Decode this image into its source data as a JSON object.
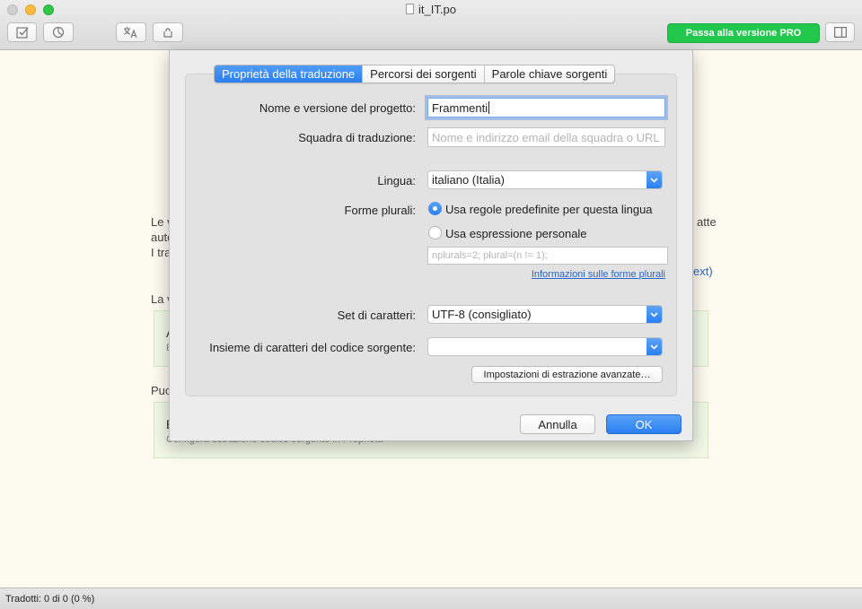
{
  "window": {
    "title": "it_IT.po",
    "pro_button": "Passa alla versione PRO"
  },
  "background": {
    "line1_start": "Le v",
    "line1_end": "atte",
    "line2_start": "auto",
    "line3_start": "I tra",
    "link_end": "ext)",
    "label_v": "La v",
    "card1_title": "A",
    "card1_sub": "E",
    "label_puo": "Puo",
    "card2_title": "E",
    "card2_sub": "Configura estrazione codice sorgente in Proprietà"
  },
  "tabs": [
    "Proprietà della traduzione",
    "Percorsi dei sorgenti",
    "Parole chiave sorgenti"
  ],
  "form": {
    "project_label": "Nome e versione del progetto:",
    "project_value": "Frammenti",
    "team_label": "Squadra di traduzione:",
    "team_placeholder": "Nome e indirizzo email della squadra o URL",
    "language_label": "Lingua:",
    "language_value": "italiano (Italia)",
    "plural_label": "Forme plurali:",
    "plural_default": "Usa regole predefinite per questa lingua",
    "plural_custom": "Usa espressione personale",
    "plural_placeholder": "nplurals=2; plural=(n != 1);",
    "plural_info_link": "Informazioni sulle forme plurali",
    "charset_label": "Set di caratteri:",
    "charset_value": "UTF-8 (consigliato)",
    "source_charset_label": "Insieme di caratteri del codice sorgente:",
    "source_charset_value": "",
    "advanced_button": "Impostazioni di estrazione avanzate…"
  },
  "buttons": {
    "cancel": "Annulla",
    "ok": "OK"
  },
  "status": {
    "text": "Tradotti: 0 di 0 (0 %)"
  }
}
